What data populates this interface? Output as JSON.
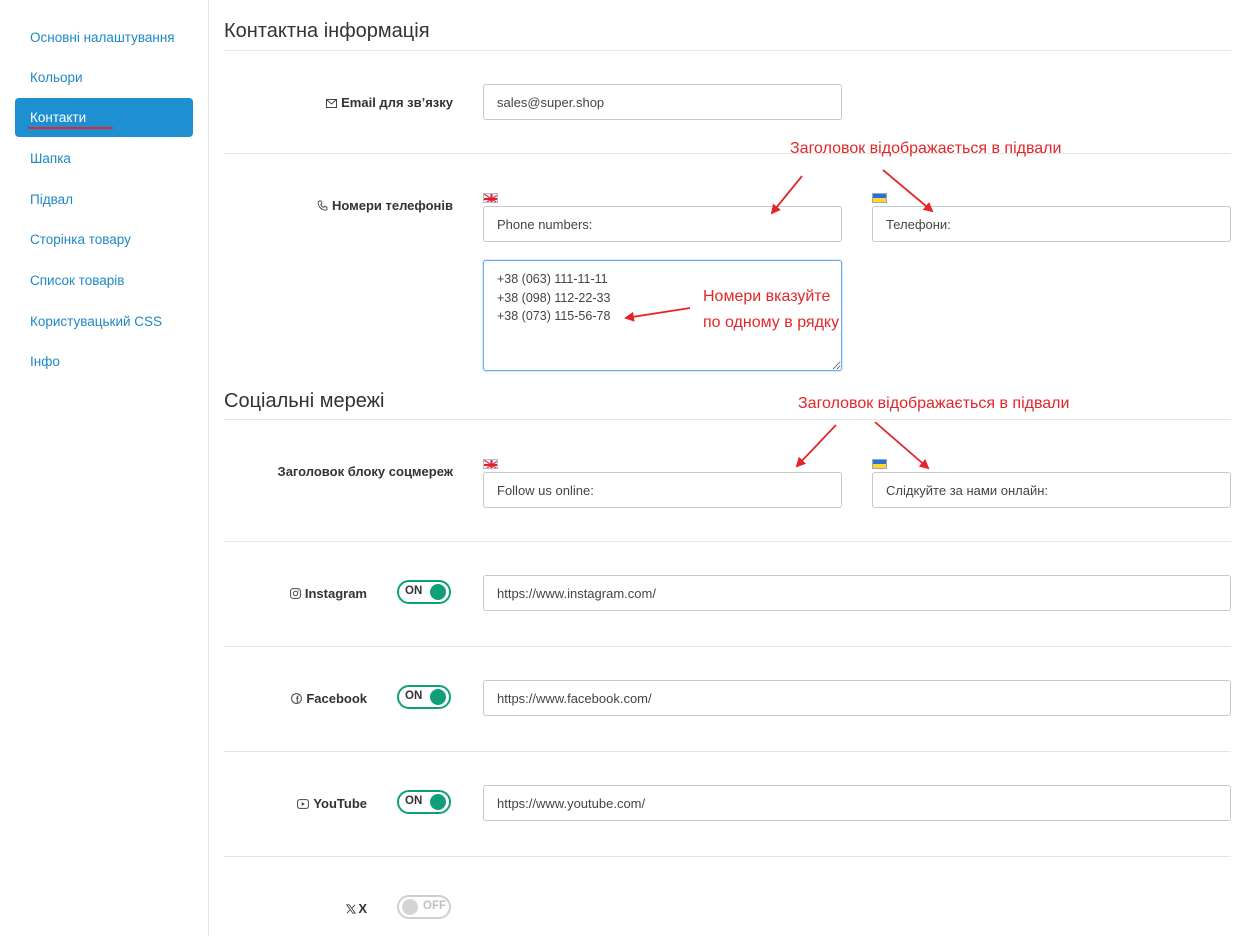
{
  "sidebar": {
    "items": [
      {
        "label": "Основні налаштування"
      },
      {
        "label": "Кольори"
      },
      {
        "label": "Контакти"
      },
      {
        "label": "Шапка"
      },
      {
        "label": "Підвал"
      },
      {
        "label": "Сторінка товару"
      },
      {
        "label": "Список товарів"
      },
      {
        "label": "Користувацький CSS"
      },
      {
        "label": "Інфо"
      }
    ],
    "active_index": 2
  },
  "contact": {
    "title": "Контактна інформація",
    "email_label": "Email для зв’язку",
    "email_value": "sales@super.shop",
    "phones_label": "Номери телефонів",
    "phones_title_en": "Phone numbers:",
    "phones_title_uk": "Телефони:",
    "phones_list": "+38 (063) 111-11-11\n+38 (098) 112-22-33\n+38 (073) 115-56-78"
  },
  "social": {
    "title": "Соціальні мережі",
    "block_title_label": "Заголовок блоку соцмереж",
    "block_title_en": "Follow us online:",
    "block_title_uk": "Слідкуйте за нами онлайн:",
    "networks": [
      {
        "label": "Instagram",
        "icon": "instagram-icon",
        "toggle": "ON",
        "enabled": true,
        "url": "https://www.instagram.com/"
      },
      {
        "label": "Facebook",
        "icon": "facebook-icon",
        "toggle": "ON",
        "enabled": true,
        "url": "https://www.facebook.com/"
      },
      {
        "label": "YouTube",
        "icon": "youtube-icon",
        "toggle": "ON",
        "enabled": true,
        "url": "https://www.youtube.com/"
      },
      {
        "label": "X",
        "icon": "x-icon",
        "toggle": "OFF",
        "enabled": false
      }
    ]
  },
  "annotations": {
    "footer_note_1": "Заголовок  відображається в підвали",
    "phones_note_line1": "Номери вказуйте",
    "phones_note_line2": "по одному в рядку",
    "footer_note_2": "Заголовок  відображається в підвали"
  },
  "colors": {
    "accent": "#1e8fd0",
    "toggle_on": "#0fa07a",
    "annotation": "#e3262a"
  }
}
